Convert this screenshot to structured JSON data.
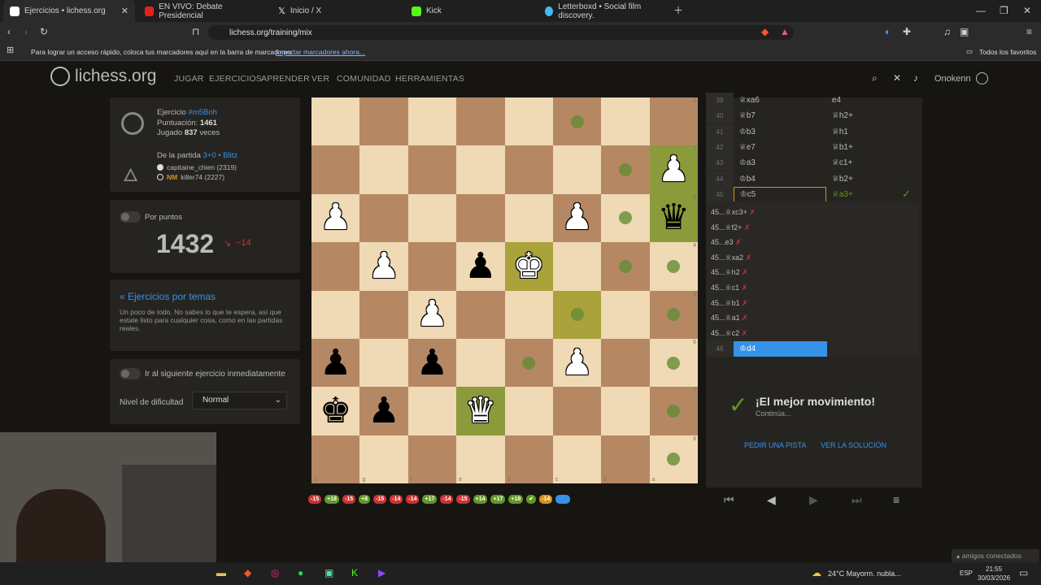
{
  "browser": {
    "tabs": [
      {
        "label": "Ejercicios • lichess.org",
        "active": true
      },
      {
        "label": "EN VIVO: Debate Presidencial"
      },
      {
        "label": "Inicio / X"
      },
      {
        "label": "Kick"
      },
      {
        "label": "Letterboxd • Social film discovery."
      }
    ],
    "url": "lichess.org/training/mix",
    "bookmarks_text": "Para lograr un acceso rápido, coloca tus marcadores aquí en la barra de marcadores.",
    "bookmarks_link": "Importar marcadores ahora...",
    "all_bookmarks": "Todos los favoritos"
  },
  "site": {
    "logo": "lichess.org",
    "nav": [
      "JUGAR",
      "EJERCICIOS",
      "APRENDER",
      "VER",
      "COMUNIDAD",
      "HERRAMIENTAS"
    ],
    "username": "Onokenn"
  },
  "puzzle": {
    "label": "Ejercicio",
    "id": "#m5Bnh",
    "rating_label": "Puntuación:",
    "rating": "1461",
    "played_prefix": "Jugado",
    "played": "837",
    "played_suffix": "veces",
    "game_prefix": "De la partida",
    "game_type": "3+0 • Blitz",
    "white_player": "capitaine_chien (2319)",
    "black_title": "NM",
    "black_player": "killer74 (2227)"
  },
  "score": {
    "toggle_label": "Por puntos",
    "rating": "1432",
    "delta": "−14"
  },
  "themes": {
    "link": "« Ejercicios por temas",
    "desc": "Un poco de todo. No sabes lo que te espera, así que estate listo para cualquier cosa, como en las partidas reales."
  },
  "settings": {
    "next_label": "Ir al siguiente ejercicio inmediatamente",
    "difficulty_label": "Nivel de dificultad",
    "difficulty_value": "Normal"
  },
  "moves": [
    {
      "n": "39",
      "w": "♕xa6",
      "b": "e4"
    },
    {
      "n": "40",
      "w": "♕b7",
      "b": "♕h2+"
    },
    {
      "n": "41",
      "w": "♔b3",
      "b": "♕h1"
    },
    {
      "n": "42",
      "w": "♕e7",
      "b": "♕b1+"
    },
    {
      "n": "43",
      "w": "♔a3",
      "b": "♕c1+"
    },
    {
      "n": "44",
      "w": "♔b4",
      "b": "♕b2+"
    },
    {
      "n": "45",
      "w": "♔c5",
      "b": "♕a3+"
    }
  ],
  "variations": [
    "45...♕xc3+",
    "45...♕f2+",
    "45...e3",
    "45...♕xa2",
    "45...♕h2",
    "45...♕c1",
    "45...♕b1",
    "45...♕a1",
    "45...♕c2"
  ],
  "current_move": {
    "n": "46",
    "w": "♔d4"
  },
  "feedback": {
    "title": "¡El mejor movimiento!",
    "subtitle": "Continúa...",
    "hint": "PEDIR UNA PISTA",
    "solution": "VER LA SOLUCIÓN"
  },
  "history": [
    "-15",
    "+18",
    "-15",
    "+8",
    "-15",
    "-14",
    "-14",
    "+17",
    "-14",
    "-15",
    "+14",
    "+17",
    "+18",
    "✔",
    "-14",
    ""
  ],
  "board": {
    "files": [
      "h",
      "g",
      "f",
      "e",
      "d",
      "c",
      "b",
      "a"
    ],
    "ranks": [
      "1",
      "2",
      "3",
      "4",
      "5",
      "6",
      "7",
      "8"
    ]
  },
  "colors": {
    "accent": "#3692e7",
    "good": "#629924",
    "bad": "#cc3333",
    "warn": "#d59120"
  },
  "taskbar": {
    "weather": "24°C  Mayorm. nubla...",
    "lang": "ESP",
    "time": "21:55",
    "date": "30/03/2026",
    "friends": "amigos conectados"
  }
}
